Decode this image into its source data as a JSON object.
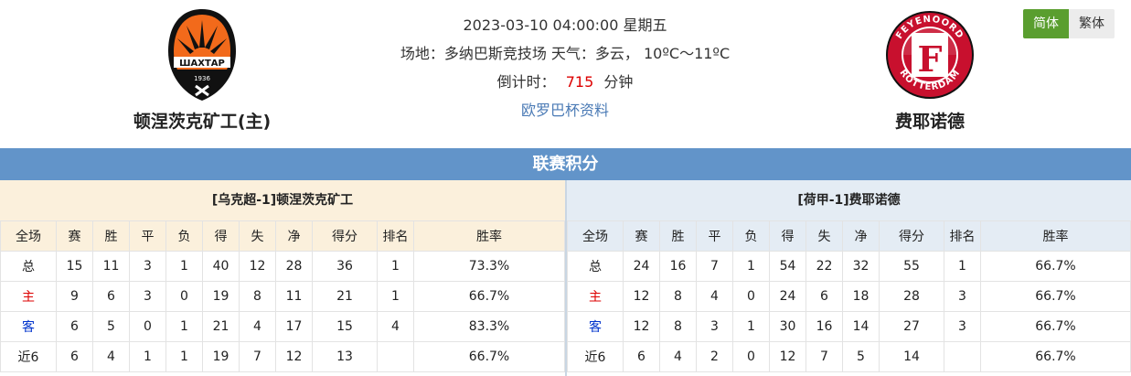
{
  "match": {
    "datetime": "2023-03-10 04:00:00 星期五",
    "venue_line": "场地：多纳巴斯竞技场 天气：多云，  10ºC～11ºC",
    "countdown_label": "倒计时：",
    "countdown_value": "715",
    "countdown_unit": "分钟",
    "info_link": "欧罗巴杯资料"
  },
  "home_team": {
    "name": "顿涅茨克矿工(主)",
    "logo_text": "ШАХТАР",
    "logo_year": "1936"
  },
  "away_team": {
    "name": "费耶诺德",
    "logo_top": "FEYENOORD",
    "logo_bottom": "ROTTERDAM",
    "logo_letter": "F"
  },
  "lang": {
    "simplified": "简体",
    "traditional": "繁体"
  },
  "section_title": "联赛积分",
  "colors": {
    "section": "#6294c9",
    "home_bg": "#fbf0dc",
    "away_bg": "#e4ecf4",
    "lang_active": "#5a9e2f",
    "highlight_red": "#dd0000",
    "highlight_blue": "#0033cc"
  },
  "headers": [
    "全场",
    "赛",
    "胜",
    "平",
    "负",
    "得",
    "失",
    "净",
    "得分",
    "排名",
    "胜率"
  ],
  "home_table": {
    "title": "[乌克超-1]顿涅茨克矿工",
    "rows": [
      [
        "总",
        "15",
        "11",
        "3",
        "1",
        "40",
        "12",
        "28",
        "36",
        "1",
        "73.3%"
      ],
      [
        "主",
        "9",
        "6",
        "3",
        "0",
        "19",
        "8",
        "11",
        "21",
        "1",
        "66.7%"
      ],
      [
        "客",
        "6",
        "5",
        "0",
        "1",
        "21",
        "4",
        "17",
        "15",
        "4",
        "83.3%"
      ],
      [
        "近6",
        "6",
        "4",
        "1",
        "1",
        "19",
        "7",
        "12",
        "13",
        "",
        "66.7%"
      ]
    ]
  },
  "away_table": {
    "title": "[荷甲-1]费耶诺德",
    "rows": [
      [
        "总",
        "24",
        "16",
        "7",
        "1",
        "54",
        "22",
        "32",
        "55",
        "1",
        "66.7%"
      ],
      [
        "主",
        "12",
        "8",
        "4",
        "0",
        "24",
        "6",
        "18",
        "28",
        "3",
        "66.7%"
      ],
      [
        "客",
        "12",
        "8",
        "3",
        "1",
        "30",
        "16",
        "14",
        "27",
        "3",
        "66.7%"
      ],
      [
        "近6",
        "6",
        "4",
        "2",
        "0",
        "12",
        "7",
        "5",
        "14",
        "",
        "66.7%"
      ]
    ]
  }
}
